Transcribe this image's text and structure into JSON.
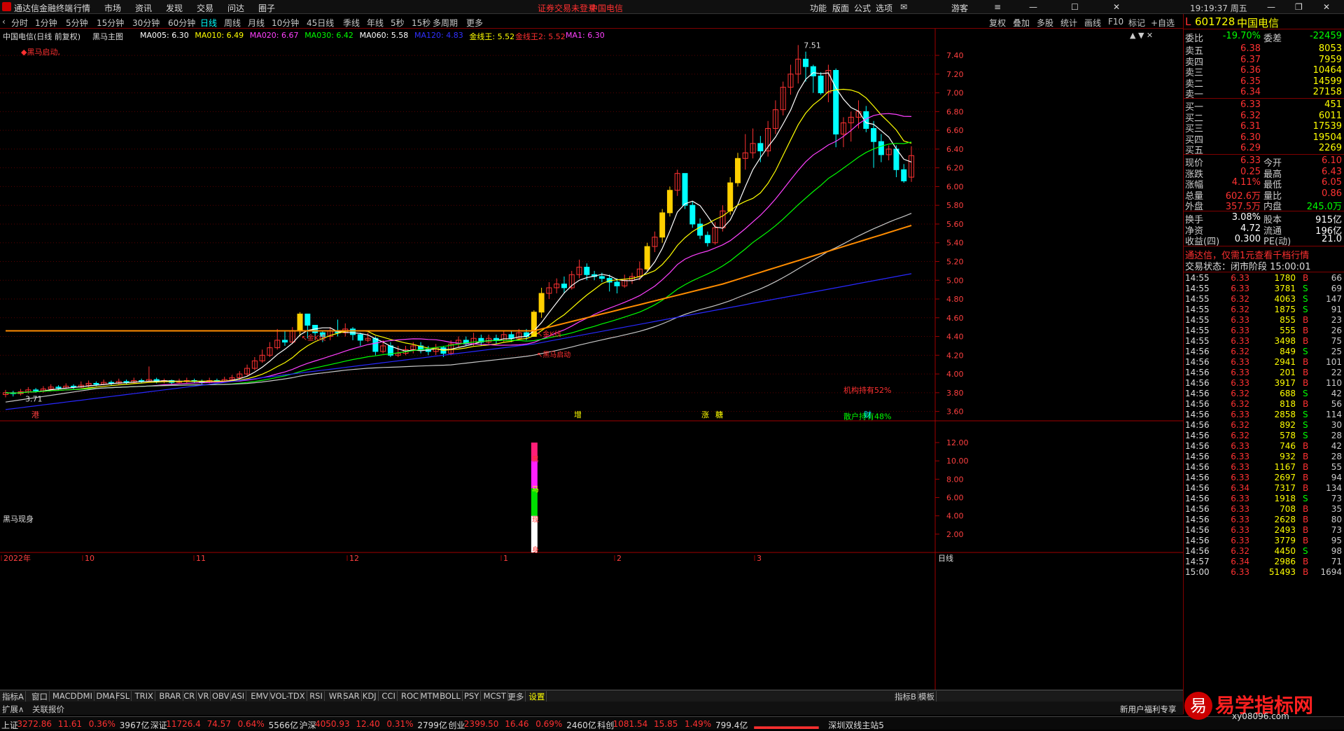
{
  "window": {
    "app_name": "通达信金融终端",
    "notice": "证券交易未登录",
    "notice_stock": "中国电信",
    "guest": "游客"
  },
  "top_menu": [
    "行情",
    "市场",
    "资讯",
    "发现",
    "交易",
    "问达",
    "圈子"
  ],
  "top_right_menu": [
    "功能",
    "版面",
    "公式",
    "选项"
  ],
  "periods": [
    "分时",
    "1分钟",
    "5分钟",
    "15分钟",
    "30分钟",
    "60分钟",
    "日线",
    "周线",
    "月线",
    "10分钟",
    "45日线",
    "季线",
    "年线",
    "5秒",
    "15秒",
    "多周期",
    "更多"
  ],
  "active_period": "日线",
  "chart_tools": [
    "复权",
    "叠加",
    "多股",
    "统计",
    "画线",
    "F10",
    "标记",
    "+自选",
    "返回"
  ],
  "main_legend": {
    "title": "中国电信(日线 前复权)",
    "indicator": "黑马主图",
    "items": [
      {
        "label": "MA005: 6.30",
        "color": "#ffffff"
      },
      {
        "label": "MA010: 6.49",
        "color": "#ffff00"
      },
      {
        "label": "MA020: 6.67",
        "color": "#ff40ff"
      },
      {
        "label": "MA030: 6.42",
        "color": "#00ff00"
      },
      {
        "label": "MA060: 5.58",
        "color": "#ffffff"
      },
      {
        "label": "MA120: 4.83",
        "color": "#3030ff"
      },
      {
        "label": "金线王: 5.52",
        "color": "#ffff00"
      },
      {
        "label": "金线王2: 5.52",
        "color": "#ff3030"
      },
      {
        "label": "MA1: 6.30",
        "color": "#ff40ff"
      }
    ],
    "signal": "◆黑马启动,"
  },
  "chart_data": {
    "type": "candlestick",
    "title": "中国电信(日线 前复权)",
    "y_ticks": [
      "7.40",
      "7.20",
      "7.00",
      "6.80",
      "6.60",
      "6.40",
      "6.20",
      "6.00",
      "5.80",
      "5.60",
      "5.40",
      "5.20",
      "5.00",
      "4.80",
      "4.60",
      "4.40",
      "4.20",
      "4.00",
      "3.80",
      "3.60"
    ],
    "ylim": [
      3.5,
      7.55
    ],
    "x_labels": [
      "2022年",
      "10",
      "11",
      "12",
      "1",
      "2",
      "3"
    ],
    "max_label": "7.51",
    "min_label": "3.71",
    "annotations": [
      "金K线",
      "金K线",
      "黑马启动",
      "机构持有52%",
      "散户持有48%"
    ],
    "event_marks": [
      "港",
      "增",
      "涨",
      "糖",
      "财"
    ],
    "candles": [
      [
        3.78,
        3.8,
        3.83,
        3.75
      ],
      [
        3.8,
        3.79,
        3.82,
        3.76
      ],
      [
        3.79,
        3.81,
        3.84,
        3.77
      ],
      [
        3.81,
        3.83,
        3.86,
        3.79
      ],
      [
        3.83,
        3.82,
        3.85,
        3.8
      ],
      [
        3.82,
        3.84,
        3.87,
        3.8
      ],
      [
        3.84,
        3.86,
        3.89,
        3.82
      ],
      [
        3.86,
        3.85,
        3.88,
        3.83
      ],
      [
        3.85,
        3.87,
        3.9,
        3.84
      ],
      [
        3.87,
        3.86,
        3.89,
        3.84
      ],
      [
        3.86,
        3.88,
        3.92,
        3.85
      ],
      [
        3.88,
        3.9,
        3.93,
        3.86
      ],
      [
        3.9,
        3.89,
        3.92,
        3.87
      ],
      [
        3.89,
        3.91,
        3.94,
        3.88
      ],
      [
        3.91,
        3.9,
        3.93,
        3.88
      ],
      [
        3.9,
        3.92,
        3.95,
        3.89
      ],
      [
        3.92,
        3.91,
        3.94,
        3.89
      ],
      [
        3.91,
        3.93,
        3.96,
        3.9
      ],
      [
        3.93,
        3.92,
        3.95,
        3.9
      ],
      [
        3.92,
        3.94,
        4.08,
        3.91
      ],
      [
        3.94,
        3.92,
        3.96,
        3.9
      ],
      [
        3.92,
        3.93,
        3.95,
        3.9
      ],
      [
        3.93,
        3.91,
        3.94,
        3.89
      ],
      [
        3.91,
        3.92,
        3.95,
        3.9
      ],
      [
        3.92,
        3.93,
        3.96,
        3.9
      ],
      [
        3.93,
        3.92,
        3.95,
        3.9
      ],
      [
        3.92,
        3.91,
        3.94,
        3.89
      ],
      [
        3.91,
        3.93,
        3.96,
        3.9
      ],
      [
        3.93,
        3.92,
        3.95,
        3.91
      ],
      [
        3.92,
        3.94,
        3.97,
        3.91
      ],
      [
        3.94,
        3.96,
        3.99,
        3.93
      ],
      [
        3.96,
        4.0,
        4.03,
        3.94
      ],
      [
        4.0,
        4.06,
        4.1,
        3.98
      ],
      [
        4.06,
        4.14,
        4.18,
        4.04
      ],
      [
        4.14,
        4.2,
        4.26,
        4.12
      ],
      [
        4.2,
        4.28,
        4.34,
        4.18
      ],
      [
        4.28,
        4.36,
        4.48,
        4.26
      ],
      [
        4.36,
        4.34,
        4.46,
        4.3
      ],
      [
        4.34,
        4.46,
        4.5,
        4.32
      ],
      [
        4.46,
        4.64,
        4.66,
        4.4
      ],
      [
        4.64,
        4.52,
        4.6,
        4.38
      ],
      [
        4.52,
        4.44,
        4.5,
        4.36
      ],
      [
        4.44,
        4.4,
        4.46,
        4.34
      ],
      [
        4.4,
        4.46,
        4.5,
        4.36
      ],
      [
        4.46,
        4.44,
        4.58,
        4.4
      ],
      [
        4.44,
        4.48,
        4.54,
        4.4
      ],
      [
        4.48,
        4.42,
        4.5,
        4.36
      ],
      [
        4.42,
        4.36,
        4.44,
        4.3
      ],
      [
        4.36,
        4.38,
        4.44,
        4.34
      ],
      [
        4.38,
        4.24,
        4.4,
        4.2
      ],
      [
        4.24,
        4.3,
        4.36,
        4.22
      ],
      [
        4.3,
        4.2,
        4.34,
        4.18
      ],
      [
        4.2,
        4.22,
        4.3,
        4.18
      ],
      [
        4.22,
        4.26,
        4.3,
        4.2
      ],
      [
        4.26,
        4.3,
        4.34,
        4.22
      ],
      [
        4.3,
        4.26,
        4.34,
        4.22
      ],
      [
        4.26,
        4.24,
        4.3,
        4.2
      ],
      [
        4.24,
        4.28,
        4.32,
        4.2
      ],
      [
        4.28,
        4.22,
        4.3,
        4.18
      ],
      [
        4.22,
        4.32,
        4.36,
        4.2
      ],
      [
        4.32,
        4.36,
        4.4,
        4.28
      ],
      [
        4.36,
        4.32,
        4.4,
        4.3
      ],
      [
        4.32,
        4.38,
        4.44,
        4.3
      ],
      [
        4.38,
        4.34,
        4.42,
        4.3
      ],
      [
        4.34,
        4.38,
        4.42,
        4.32
      ],
      [
        4.38,
        4.36,
        4.42,
        4.32
      ],
      [
        4.36,
        4.42,
        4.46,
        4.34
      ],
      [
        4.42,
        4.38,
        4.46,
        4.34
      ],
      [
        4.38,
        4.44,
        4.48,
        4.36
      ],
      [
        4.44,
        4.4,
        4.48,
        4.36
      ],
      [
        4.4,
        4.66,
        4.68,
        4.4
      ],
      [
        4.66,
        4.86,
        4.92,
        4.6
      ],
      [
        4.86,
        4.92,
        4.98,
        4.8
      ],
      [
        4.92,
        4.96,
        5.02,
        4.86
      ],
      [
        4.96,
        4.92,
        5.04,
        4.86
      ],
      [
        4.92,
        5.06,
        5.1,
        4.9
      ],
      [
        5.06,
        5.14,
        5.22,
        5.02
      ],
      [
        5.14,
        5.06,
        5.18,
        5.0
      ],
      [
        5.06,
        5.04,
        5.1,
        5.0
      ],
      [
        5.04,
        5.02,
        5.08,
        4.98
      ],
      [
        5.02,
        4.98,
        5.06,
        4.88
      ],
      [
        4.98,
        4.94,
        5.02,
        4.86
      ],
      [
        4.94,
        5.0,
        5.06,
        4.92
      ],
      [
        5.0,
        5.04,
        5.08,
        4.96
      ],
      [
        5.04,
        5.12,
        5.2,
        5.0
      ],
      [
        5.12,
        5.36,
        5.4,
        5.1
      ],
      [
        5.36,
        5.46,
        5.52,
        5.3
      ],
      [
        5.46,
        5.72,
        5.76,
        5.4
      ],
      [
        5.72,
        5.96,
        6.0,
        5.68
      ],
      [
        5.96,
        6.14,
        6.18,
        5.9
      ],
      [
        6.14,
        5.8,
        6.06,
        5.76
      ],
      [
        5.8,
        5.6,
        5.84,
        5.56
      ],
      [
        5.6,
        5.48,
        5.66,
        5.44
      ],
      [
        5.48,
        5.4,
        5.52,
        5.36
      ],
      [
        5.4,
        5.56,
        5.62,
        5.38
      ],
      [
        5.56,
        5.74,
        5.8,
        5.52
      ],
      [
        5.74,
        6.04,
        6.1,
        5.7
      ],
      [
        6.04,
        6.3,
        6.36,
        6.0
      ],
      [
        6.3,
        6.36,
        6.56,
        6.18
      ],
      [
        6.36,
        6.46,
        6.62,
        6.3
      ],
      [
        6.46,
        6.38,
        6.54,
        6.26
      ],
      [
        6.38,
        6.62,
        6.7,
        6.32
      ],
      [
        6.62,
        6.82,
        6.92,
        6.56
      ],
      [
        6.82,
        7.06,
        7.12,
        6.76
      ],
      [
        7.06,
        7.2,
        7.3,
        6.98
      ],
      [
        7.2,
        7.36,
        7.51,
        7.1
      ],
      [
        7.36,
        7.28,
        7.44,
        7.12
      ],
      [
        7.28,
        7.18,
        7.3,
        7.0
      ],
      [
        7.18,
        7.0,
        7.22,
        6.98
      ],
      [
        7.0,
        7.24,
        7.3,
        6.9
      ],
      [
        7.24,
        6.56,
        7.26,
        6.42
      ],
      [
        6.56,
        6.68,
        6.74,
        6.42
      ],
      [
        6.68,
        6.74,
        6.8,
        6.48
      ],
      [
        6.74,
        6.8,
        6.92,
        6.62
      ],
      [
        6.8,
        6.62,
        6.86,
        6.58
      ],
      [
        6.62,
        6.48,
        6.7,
        6.2
      ],
      [
        6.48,
        6.34,
        6.56,
        6.26
      ],
      [
        6.34,
        6.4,
        6.44,
        6.28
      ],
      [
        6.4,
        6.18,
        6.44,
        6.1
      ],
      [
        6.18,
        6.06,
        6.24,
        6.04
      ],
      [
        6.1,
        6.33,
        6.43,
        6.05
      ]
    ],
    "ma_lines": [
      {
        "name": "MA005",
        "color": "#ffffff"
      },
      {
        "name": "MA010",
        "color": "#ffff00"
      },
      {
        "name": "MA020",
        "color": "#ff40ff"
      },
      {
        "name": "MA030",
        "color": "#00ff00"
      },
      {
        "name": "MA060",
        "color": "#c8c8c8"
      },
      {
        "name": "MA120",
        "color": "#2828ff"
      },
      {
        "name": "金线王",
        "color": "#ff8c00"
      }
    ]
  },
  "sub_chart": {
    "title": "黑马现身",
    "y_ticks": [
      "12.00",
      "10.00",
      "8.00",
      "6.00",
      "4.00",
      "2.00"
    ],
    "bar_chars": [
      "黑",
      "马",
      "现",
      "身"
    ]
  },
  "tabs": [
    "指标A",
    "窗口",
    "MACD",
    "DMI",
    "DMA",
    "FSL",
    "TRIX",
    "BRAR",
    "CR",
    "VR",
    "OBV",
    "ASI",
    "EMV",
    "VOL-TDX",
    "RSI",
    "WR",
    "SAR",
    "KDJ",
    "CCI",
    "ROC",
    "MTM",
    "BOLL",
    "PSY",
    "MCST",
    "更多",
    "设置"
  ],
  "tab_right": [
    "指标B",
    "模板"
  ],
  "period_label": "日线",
  "ext": [
    "扩展∧",
    "关联报价"
  ],
  "ext_right": "新用户福利专享",
  "right_panel": {
    "header": {
      "tag": "L",
      "code": "601728",
      "name": "中国电信",
      "clock": "19:19:37 周五"
    },
    "webi": {
      "label": "委比",
      "value": "-19.70%",
      "label2": "委差",
      "value2": "-22459"
    },
    "asks": [
      {
        "l": "卖五",
        "p": "6.38",
        "v": "8053"
      },
      {
        "l": "卖四",
        "p": "6.37",
        "v": "7959"
      },
      {
        "l": "卖三",
        "p": "6.36",
        "v": "10464"
      },
      {
        "l": "卖二",
        "p": "6.35",
        "v": "14599"
      },
      {
        "l": "卖一",
        "p": "6.34",
        "v": "27158"
      }
    ],
    "bids": [
      {
        "l": "买一",
        "p": "6.33",
        "v": "451"
      },
      {
        "l": "买二",
        "p": "6.32",
        "v": "6011"
      },
      {
        "l": "买三",
        "p": "6.31",
        "v": "17539"
      },
      {
        "l": "买四",
        "p": "6.30",
        "v": "19504"
      },
      {
        "l": "买五",
        "p": "6.29",
        "v": "2269"
      }
    ],
    "quote": [
      {
        "l1": "现价",
        "v1": "6.33",
        "l2": "今开",
        "v2": "6.10"
      },
      {
        "l1": "涨跌",
        "v1": "0.25",
        "l2": "最高",
        "v2": "6.43"
      },
      {
        "l1": "涨幅",
        "v1": "4.11%",
        "l2": "最低",
        "v2": "6.05"
      },
      {
        "l1": "总量",
        "v1": "602.6万",
        "l2": "量比",
        "v2": "0.86"
      },
      {
        "l1": "外盘",
        "v1": "357.5万",
        "l2": "内盘",
        "v2": "245.0万"
      }
    ],
    "fund": [
      {
        "l1": "换手",
        "v1": "3.08%",
        "l2": "股本",
        "v2": "915亿"
      },
      {
        "l1": "净资",
        "v1": "4.72",
        "l2": "流通",
        "v2": "196亿"
      },
      {
        "l1": "收益(四)",
        "v1": "0.300",
        "l2": "PE(动)",
        "v2": "21.0"
      }
    ],
    "ad": "通达信，仅需1元查看千档行情",
    "status": "交易状态：闭市阶段 15:00:01",
    "ticks": [
      [
        "14:55",
        "6.33",
        "1780",
        "B",
        "66"
      ],
      [
        "14:55",
        "6.33",
        "3781",
        "S",
        "69"
      ],
      [
        "14:55",
        "6.32",
        "4063",
        "S",
        "147"
      ],
      [
        "14:55",
        "6.32",
        "1875",
        "S",
        "91"
      ],
      [
        "14:55",
        "6.33",
        "855",
        "B",
        "23"
      ],
      [
        "14:55",
        "6.33",
        "555",
        "B",
        "26"
      ],
      [
        "14:55",
        "6.33",
        "3498",
        "B",
        "75"
      ],
      [
        "14:56",
        "6.32",
        "849",
        "S",
        "25"
      ],
      [
        "14:56",
        "6.33",
        "2941",
        "B",
        "101"
      ],
      [
        "14:56",
        "6.33",
        "201",
        "B",
        "22"
      ],
      [
        "14:56",
        "6.33",
        "3917",
        "B",
        "110"
      ],
      [
        "14:56",
        "6.32",
        "688",
        "S",
        "42"
      ],
      [
        "14:56",
        "6.32",
        "818",
        "B",
        "56"
      ],
      [
        "14:56",
        "6.33",
        "2858",
        "S",
        "114"
      ],
      [
        "14:56",
        "6.32",
        "892",
        "S",
        "30"
      ],
      [
        "14:56",
        "6.32",
        "578",
        "S",
        "28"
      ],
      [
        "14:56",
        "6.33",
        "746",
        "B",
        "42"
      ],
      [
        "14:56",
        "6.33",
        "932",
        "B",
        "28"
      ],
      [
        "14:56",
        "6.33",
        "1167",
        "B",
        "55"
      ],
      [
        "14:56",
        "6.33",
        "2697",
        "B",
        "94"
      ],
      [
        "14:56",
        "6.34",
        "7317",
        "B",
        "134"
      ],
      [
        "14:56",
        "6.33",
        "1918",
        "S",
        "73"
      ],
      [
        "14:56",
        "6.33",
        "708",
        "B",
        "35"
      ],
      [
        "14:56",
        "6.33",
        "2628",
        "B",
        "80"
      ],
      [
        "14:56",
        "6.33",
        "2493",
        "B",
        "73"
      ],
      [
        "14:56",
        "6.33",
        "3779",
        "B",
        "95"
      ],
      [
        "14:56",
        "6.32",
        "4450",
        "S",
        "98"
      ],
      [
        "14:57",
        "6.34",
        "2986",
        "B",
        "71"
      ],
      [
        "15:00",
        "6.33",
        "51493",
        "B",
        "1694"
      ]
    ]
  },
  "status_bar": [
    {
      "name": "上证",
      "v": "3272.86",
      "c": "11.61",
      "p": "0.36%",
      "a": "3967亿"
    },
    {
      "name": "深证",
      "v": "11726.4",
      "c": "74.57",
      "p": "0.64%",
      "a": "5566亿"
    },
    {
      "name": "沪深",
      "v": "4050.93",
      "c": "12.40",
      "p": "0.31%",
      "a": "2799亿"
    },
    {
      "name": "创业",
      "v": "2399.50",
      "c": "16.46",
      "p": "0.69%",
      "a": "2460亿"
    },
    {
      "name": "科创",
      "v": "1081.54",
      "c": "15.85",
      "p": "1.49%",
      "a": "799.4亿"
    }
  ],
  "station": "深圳双线主站5",
  "watermark": "易学指标网",
  "watermark_sub": "xy08096.com"
}
